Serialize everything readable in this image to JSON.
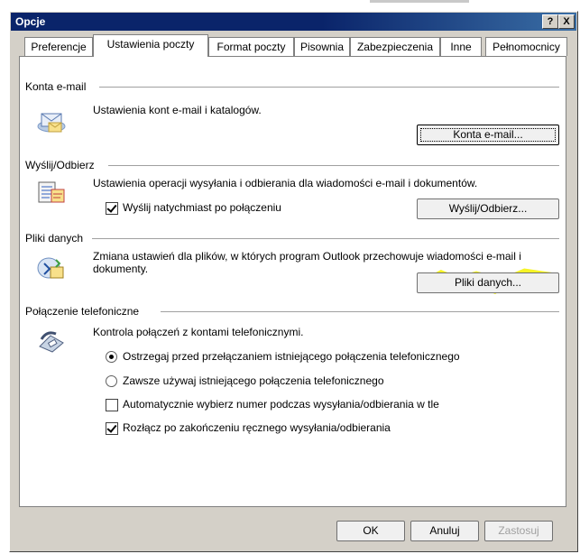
{
  "window": {
    "title": "Opcje"
  },
  "titlebar_buttons": [
    {
      "label": "?"
    },
    {
      "label": "X"
    }
  ],
  "tabs": [
    {
      "label": "Preferencje"
    },
    {
      "label": "Ustawienia poczty"
    },
    {
      "label": "Format poczty"
    },
    {
      "label": "Pisownia"
    },
    {
      "label": "Zabezpieczenia"
    },
    {
      "label": "Inne"
    },
    {
      "label": "Pełnomocnicy"
    }
  ],
  "sections": {
    "accounts": {
      "title": "Konta e-mail",
      "description": "Ustawienia kont e-mail i katalogów.",
      "button": "Konta e-mail..."
    },
    "send_receive": {
      "title": "Wyślij/Odbierz",
      "description": "Ustawienia operacji wysyłania i odbierania dla wiadomości e-mail i dokumentów.",
      "checkbox": {
        "label": "Wyślij natychmiast po połączeniu",
        "checked": true
      },
      "button": "Wyślij/Odbierz..."
    },
    "data_files": {
      "title": "Pliki danych",
      "description_line1": "Zmiana ustawień dla plików, w których program Outlook przechowuje wiadomości e-mail i",
      "description_line2": "dokumenty.",
      "button": "Pliki danych..."
    },
    "dialup": {
      "title": "Połączenie telefoniczne",
      "description": "Kontrola połączeń z kontami telefonicznymi.",
      "radio_warn": {
        "label": "Ostrzegaj przed przełączaniem istniejącego połączenia telefonicznego",
        "checked": true
      },
      "radio_always": {
        "label": "Zawsze używaj istniejącego połączenia telefonicznego",
        "checked": false
      },
      "checkbox_auto": {
        "label": "Automatycznie wybierz numer podczas wysyłania/odbierania w tle",
        "checked": false
      },
      "checkbox_hangup": {
        "label": "Rozłącz po zakończeniu ręcznego wysyłania/odbierania",
        "checked": true
      }
    }
  },
  "footer": {
    "ok": "OK",
    "cancel": "Anuluj",
    "apply": "Zastosuj"
  }
}
